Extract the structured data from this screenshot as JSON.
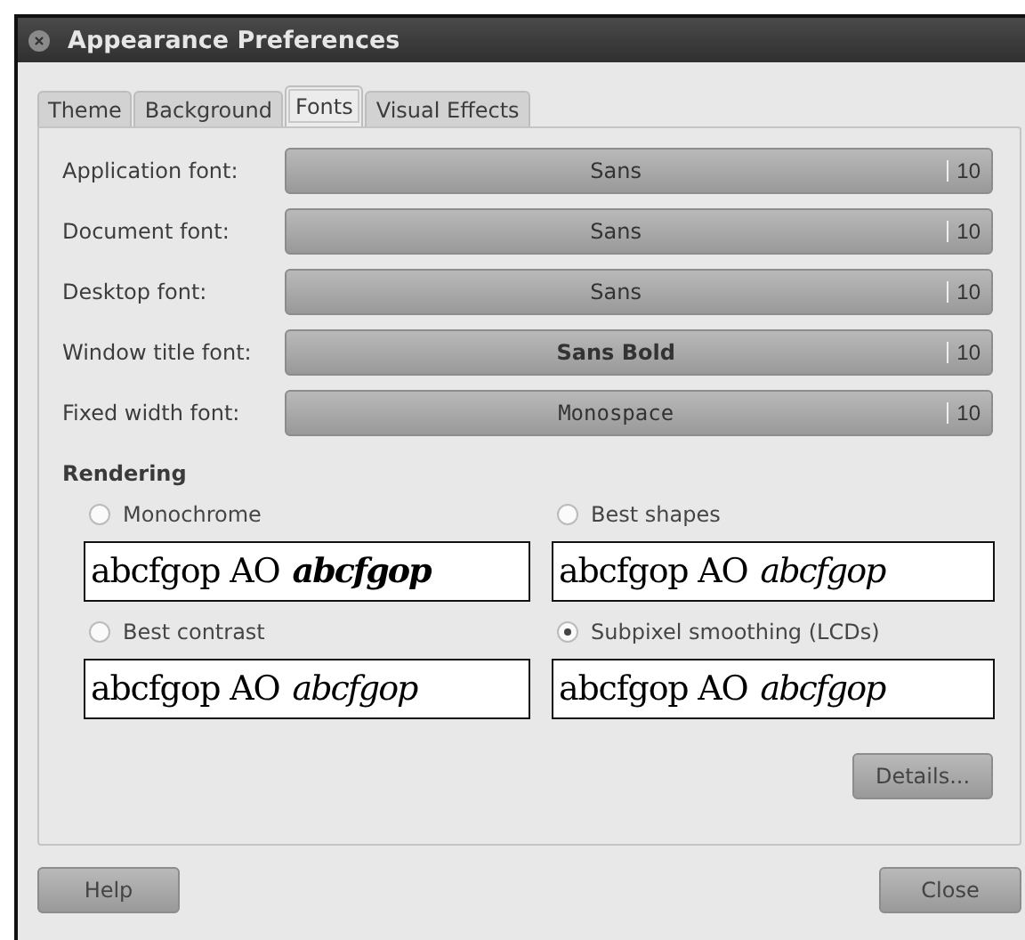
{
  "window": {
    "title": "Appearance Preferences"
  },
  "tabs": [
    {
      "label": "Theme",
      "selected": false
    },
    {
      "label": "Background",
      "selected": false
    },
    {
      "label": "Fonts",
      "selected": true
    },
    {
      "label": "Visual Effects",
      "selected": false
    }
  ],
  "fonts": [
    {
      "label": "Application font:",
      "font": "Sans",
      "kind": "regular",
      "size": "10"
    },
    {
      "label": "Document font:",
      "font": "Sans",
      "kind": "regular",
      "size": "10"
    },
    {
      "label": "Desktop font:",
      "font": "Sans",
      "kind": "regular",
      "size": "10"
    },
    {
      "label": "Window title font:",
      "font": "Sans Bold",
      "kind": "bold",
      "size": "10"
    },
    {
      "label": "Fixed width font:",
      "font": "Monospace",
      "kind": "mono",
      "size": "10"
    }
  ],
  "rendering": {
    "heading": "Rendering",
    "options": [
      {
        "label": "Monochrome",
        "selected": false,
        "sample": "abcfgop AO",
        "sample_italic": "abcfgop"
      },
      {
        "label": "Best shapes",
        "selected": false,
        "sample": "abcfgop AO",
        "sample_italic": "abcfgop"
      },
      {
        "label": "Best contrast",
        "selected": false,
        "sample": "abcfgop AO",
        "sample_italic": "abcfgop"
      },
      {
        "label": "Subpixel smoothing (LCDs)",
        "selected": true,
        "sample": "abcfgop AO",
        "sample_italic": "abcfgop"
      }
    ],
    "details_button": "Details..."
  },
  "buttons": {
    "help": "Help",
    "close": "Close"
  }
}
